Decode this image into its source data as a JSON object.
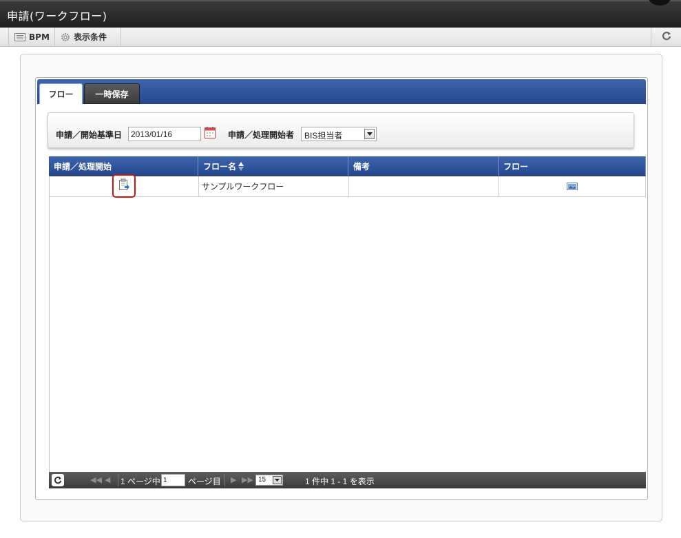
{
  "window": {
    "title": "申請(ワークフロー)"
  },
  "toolbar": {
    "bpm_label": "BPM",
    "conditions_label": "表示条件",
    "icons": {
      "bpm": "list-icon",
      "conditions": "gear-icon",
      "refresh": "refresh-icon"
    }
  },
  "tabs": [
    {
      "label": "フロー",
      "active": true
    },
    {
      "label": "一時保存",
      "active": false
    }
  ],
  "search": {
    "base_date_label": "申請／開始基準日",
    "base_date_value": "2013/01/16",
    "applicant_label": "申請／処理開始者",
    "applicant_value": "BIS担当者"
  },
  "grid": {
    "columns": [
      "申請／処理開始",
      "フロー名",
      "備考",
      "フロー"
    ],
    "sort_indicator": "▲▼",
    "rows": [
      {
        "flow_name": "サンプルワークフロー",
        "remarks": ""
      }
    ]
  },
  "pager": {
    "page_prefix": "1 ページ中",
    "page_value": "1",
    "page_suffix": "ページ目",
    "page_size": "15",
    "summary": "1 件中 1 - 1 を表示"
  },
  "colors": {
    "header_blue": "#2e52a0",
    "title_bar": "#2b2b2b",
    "highlight_red": "#d01515"
  }
}
